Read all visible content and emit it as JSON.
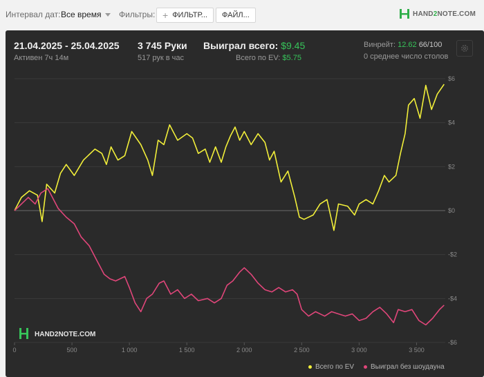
{
  "toolbar": {
    "interval_label": "Интервал дат:",
    "interval_value": "Все время",
    "filters_label": "Фильтры:",
    "filters_button": "ФИЛЬТР...",
    "files_button": "ФАЙЛ...",
    "logo": "HAND2NOTE.COM",
    "logo_parts": [
      "HAND",
      "2",
      "NOTE.COM"
    ]
  },
  "summary": {
    "date_range": "21.04.2025 - 25.04.2025",
    "active": "Активен 7ч 14м",
    "hands": "3 745 Руки",
    "hands_per_hour": "517 рук в час",
    "won_label": "Выиграл всего:",
    "won_value": "$9.45",
    "ev_label": "Всего по EV:",
    "ev_value": "$5.75",
    "winrate_label": "Винрейт:",
    "winrate_value": "12.62",
    "winrate_unit": "66/100",
    "avg_tables": "0 среднее число столов"
  },
  "colors": {
    "ev_line": "#f2ef3a",
    "no_showdown_line": "#e0467a",
    "accent_green": "#37c45a",
    "panel_bg": "#2a2a2a"
  },
  "chart_data": {
    "type": "line",
    "x_ticks": [
      0,
      500,
      1000,
      1500,
      2000,
      2500,
      3000,
      3500
    ],
    "x_tick_labels": [
      "0",
      "500",
      "1 000",
      "1 500",
      "2 000",
      "2 500",
      "3 000",
      "3 500"
    ],
    "y_ticks": [
      6,
      4,
      2,
      0,
      -2,
      -4,
      -6
    ],
    "y_tick_labels": [
      "$6",
      "$4",
      "$2",
      "$0",
      "-$2",
      "-$4",
      "-$6"
    ],
    "xlim": [
      0,
      3750
    ],
    "ylim": [
      -6,
      6
    ],
    "grid": true,
    "watermark": "HAND2NOTE.COM",
    "legend_position": "bottom-right",
    "series": [
      {
        "name": "Всего по EV",
        "color_key": "ev_line",
        "points": [
          [
            0,
            0
          ],
          [
            60,
            0.6
          ],
          [
            130,
            0.9
          ],
          [
            200,
            0.7
          ],
          [
            240,
            -0.5
          ],
          [
            280,
            1.2
          ],
          [
            350,
            0.8
          ],
          [
            400,
            1.7
          ],
          [
            450,
            2.1
          ],
          [
            520,
            1.6
          ],
          [
            600,
            2.3
          ],
          [
            700,
            2.8
          ],
          [
            760,
            2.6
          ],
          [
            800,
            2.1
          ],
          [
            840,
            2.9
          ],
          [
            900,
            2.3
          ],
          [
            960,
            2.5
          ],
          [
            1020,
            3.6
          ],
          [
            1100,
            3.0
          ],
          [
            1160,
            2.3
          ],
          [
            1200,
            1.6
          ],
          [
            1250,
            3.2
          ],
          [
            1300,
            3.0
          ],
          [
            1350,
            3.9
          ],
          [
            1420,
            3.2
          ],
          [
            1500,
            3.5
          ],
          [
            1550,
            3.3
          ],
          [
            1600,
            2.6
          ],
          [
            1660,
            2.8
          ],
          [
            1700,
            2.2
          ],
          [
            1750,
            2.9
          ],
          [
            1800,
            2.2
          ],
          [
            1840,
            2.9
          ],
          [
            1880,
            3.4
          ],
          [
            1920,
            3.8
          ],
          [
            1960,
            3.2
          ],
          [
            2000,
            3.6
          ],
          [
            2060,
            3.0
          ],
          [
            2120,
            3.5
          ],
          [
            2180,
            3.1
          ],
          [
            2220,
            2.3
          ],
          [
            2260,
            2.7
          ],
          [
            2320,
            1.3
          ],
          [
            2380,
            1.8
          ],
          [
            2440,
            0.6
          ],
          [
            2480,
            -0.3
          ],
          [
            2520,
            -0.4
          ],
          [
            2600,
            -0.2
          ],
          [
            2660,
            0.3
          ],
          [
            2720,
            0.5
          ],
          [
            2780,
            -0.9
          ],
          [
            2820,
            0.3
          ],
          [
            2900,
            0.2
          ],
          [
            2960,
            -0.2
          ],
          [
            3000,
            0.3
          ],
          [
            3060,
            0.5
          ],
          [
            3120,
            0.3
          ],
          [
            3170,
            0.9
          ],
          [
            3220,
            1.6
          ],
          [
            3260,
            1.3
          ],
          [
            3320,
            1.6
          ],
          [
            3360,
            2.6
          ],
          [
            3400,
            3.5
          ],
          [
            3430,
            4.8
          ],
          [
            3480,
            5.1
          ],
          [
            3530,
            4.2
          ],
          [
            3580,
            5.7
          ],
          [
            3630,
            4.6
          ],
          [
            3680,
            5.3
          ],
          [
            3740,
            5.75
          ]
        ]
      },
      {
        "name": "Выиграл без шоудауна",
        "color_key": "no_showdown_line",
        "points": [
          [
            0,
            0
          ],
          [
            60,
            0.3
          ],
          [
            120,
            0.6
          ],
          [
            180,
            0.3
          ],
          [
            230,
            0.8
          ],
          [
            290,
            1.0
          ],
          [
            330,
            0.6
          ],
          [
            380,
            0.1
          ],
          [
            450,
            -0.3
          ],
          [
            520,
            -0.6
          ],
          [
            580,
            -1.2
          ],
          [
            650,
            -1.6
          ],
          [
            720,
            -2.3
          ],
          [
            780,
            -2.9
          ],
          [
            830,
            -3.1
          ],
          [
            880,
            -3.2
          ],
          [
            960,
            -3.0
          ],
          [
            1000,
            -3.5
          ],
          [
            1050,
            -4.2
          ],
          [
            1100,
            -4.6
          ],
          [
            1150,
            -4.0
          ],
          [
            1200,
            -3.8
          ],
          [
            1260,
            -3.3
          ],
          [
            1300,
            -3.2
          ],
          [
            1360,
            -3.8
          ],
          [
            1420,
            -3.6
          ],
          [
            1480,
            -4.0
          ],
          [
            1540,
            -3.8
          ],
          [
            1600,
            -4.1
          ],
          [
            1680,
            -4.0
          ],
          [
            1740,
            -4.2
          ],
          [
            1800,
            -4.0
          ],
          [
            1850,
            -3.4
          ],
          [
            1900,
            -3.2
          ],
          [
            1960,
            -2.8
          ],
          [
            2000,
            -2.6
          ],
          [
            2060,
            -2.9
          ],
          [
            2120,
            -3.3
          ],
          [
            2180,
            -3.6
          ],
          [
            2240,
            -3.7
          ],
          [
            2300,
            -3.5
          ],
          [
            2360,
            -3.7
          ],
          [
            2420,
            -3.6
          ],
          [
            2460,
            -3.8
          ],
          [
            2500,
            -4.5
          ],
          [
            2560,
            -4.8
          ],
          [
            2620,
            -4.6
          ],
          [
            2700,
            -4.8
          ],
          [
            2760,
            -4.6
          ],
          [
            2820,
            -4.7
          ],
          [
            2880,
            -4.8
          ],
          [
            2940,
            -4.7
          ],
          [
            3000,
            -5.0
          ],
          [
            3060,
            -4.9
          ],
          [
            3120,
            -4.6
          ],
          [
            3180,
            -4.4
          ],
          [
            3240,
            -4.7
          ],
          [
            3300,
            -5.1
          ],
          [
            3340,
            -4.5
          ],
          [
            3400,
            -4.6
          ],
          [
            3460,
            -4.5
          ],
          [
            3520,
            -5.0
          ],
          [
            3580,
            -5.2
          ],
          [
            3640,
            -4.9
          ],
          [
            3700,
            -4.5
          ],
          [
            3740,
            -4.3
          ]
        ]
      }
    ]
  }
}
